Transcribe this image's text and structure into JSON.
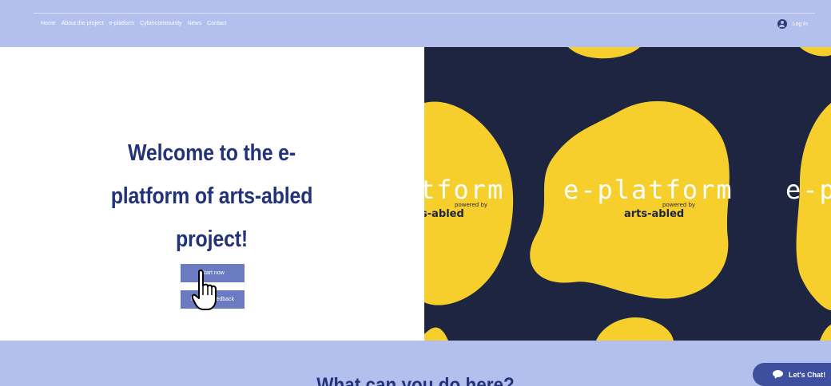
{
  "nav": {
    "items": [
      "Home",
      "About the project",
      "e-platform",
      "Cybercommunity",
      "News",
      "Contact"
    ],
    "login_label": "Log In"
  },
  "hero": {
    "title_lines": [
      "Welcome to the e-",
      "platform of arts-abled",
      "project!"
    ],
    "start_button": "Start now",
    "feedback_button": "Provide feedback"
  },
  "banner": {
    "logo_text": "e-platform",
    "left_logo_fragment": "tform",
    "right_logo_fragment": "e-p",
    "powered_by": "powered by",
    "brand": "arts-abled",
    "left_brand_fragment": "s-abled",
    "colors": {
      "background": "#1d2540",
      "blob": "#f6cf2d"
    }
  },
  "section": {
    "title": "What can you do here?"
  },
  "chat": {
    "label": "Let's Chat!"
  },
  "colors": {
    "header": "#b3c0ee",
    "title": "#23337a",
    "button": "#6b7bc2"
  }
}
